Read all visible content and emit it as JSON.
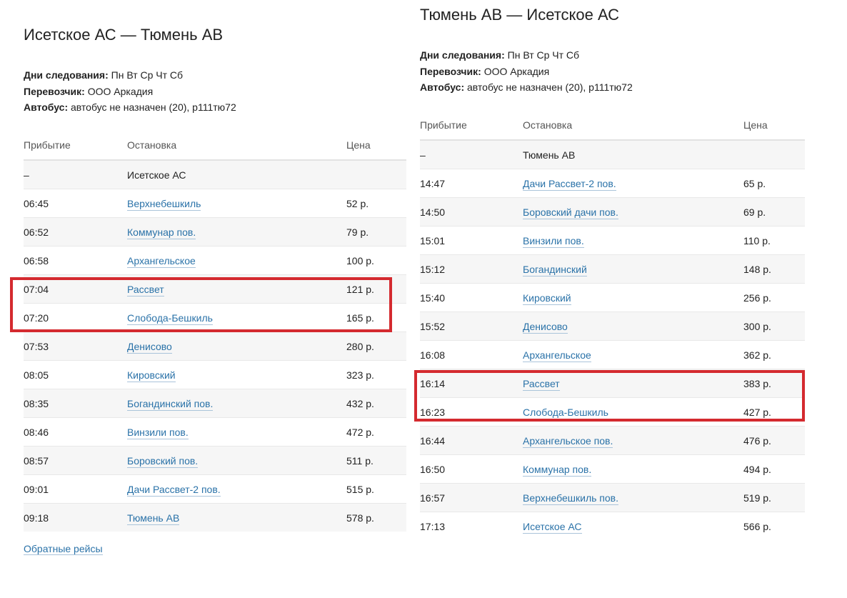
{
  "left": {
    "title": "Исетское АС — Тюмень АВ",
    "days_label": "Дни следования:",
    "days_value": "Пн Вт Ср Чт Сб",
    "carrier_label": "Перевозчик:",
    "carrier_value": "ООО Аркадия",
    "bus_label": "Автобус:",
    "bus_value": "автобус не назначен (20), р111тю72",
    "headers": {
      "arrival": "Прибытие",
      "stop": "Остановка",
      "price": "Цена"
    },
    "rows": [
      {
        "time": "–",
        "stop": "Исетское АС",
        "price": "",
        "link": false
      },
      {
        "time": "06:45",
        "stop": "Верхнебешкиль",
        "price": "52 р.",
        "link": true
      },
      {
        "time": "06:52",
        "stop": "Коммунар пов.",
        "price": "79 р.",
        "link": true
      },
      {
        "time": "06:58",
        "stop": "Архангельское",
        "price": "100 р.",
        "link": true
      },
      {
        "time": "07:04",
        "stop": "Рассвет",
        "price": "121 р.",
        "link": true
      },
      {
        "time": "07:20",
        "stop": "Слобода-Бешкиль",
        "price": "165 р.",
        "link": true
      },
      {
        "time": "07:53",
        "stop": "Денисово",
        "price": "280 р.",
        "link": true
      },
      {
        "time": "08:05",
        "stop": "Кировский",
        "price": "323 р.",
        "link": true
      },
      {
        "time": "08:35",
        "stop": "Богандинский пов.",
        "price": "432 р.",
        "link": true
      },
      {
        "time": "08:46",
        "stop": "Винзили пов.",
        "price": "472 р.",
        "link": true
      },
      {
        "time": "08:57",
        "stop": "Боровский пов.",
        "price": "511 р.",
        "link": true
      },
      {
        "time": "09:01",
        "stop": "Дачи Рассвет-2 пов.",
        "price": "515 р.",
        "link": true
      },
      {
        "time": "09:18",
        "stop": "Тюмень АВ",
        "price": "578 р.",
        "link": true
      }
    ],
    "back_link": "Обратные рейсы"
  },
  "right": {
    "title": "Тюмень АВ — Исетское АС",
    "days_label": "Дни следования:",
    "days_value": "Пн Вт Ср Чт Сб",
    "carrier_label": "Перевозчик:",
    "carrier_value": "ООО Аркадия",
    "bus_label": "Автобус:",
    "bus_value": "автобус не назначен (20), р111тю72",
    "headers": {
      "arrival": "Прибытие",
      "stop": "Остановка",
      "price": "Цена"
    },
    "rows": [
      {
        "time": "–",
        "stop": "Тюмень АВ",
        "price": "",
        "link": false
      },
      {
        "time": "14:47",
        "stop": "Дачи Рассвет-2 пов.",
        "price": "65 р.",
        "link": true
      },
      {
        "time": "14:50",
        "stop": "Боровский дачи пов.",
        "price": "69 р.",
        "link": true
      },
      {
        "time": "15:01",
        "stop": "Винзили пов.",
        "price": "110 р.",
        "link": true
      },
      {
        "time": "15:12",
        "stop": "Богандинский",
        "price": "148 р.",
        "link": true
      },
      {
        "time": "15:40",
        "stop": "Кировский",
        "price": "256 р.",
        "link": true
      },
      {
        "time": "15:52",
        "stop": "Денисово",
        "price": "300 р.",
        "link": true
      },
      {
        "time": "16:08",
        "stop": "Архангельское",
        "price": "362 р.",
        "link": true
      },
      {
        "time": "16:14",
        "stop": "Рассвет",
        "price": "383 р.",
        "link": true
      },
      {
        "time": "16:23",
        "stop": "Слобода-Бешкиль",
        "price": "427 р.",
        "link": true
      },
      {
        "time": "16:44",
        "stop": "Архангельское пов.",
        "price": "476 р.",
        "link": true
      },
      {
        "time": "16:50",
        "stop": "Коммунар пов.",
        "price": "494 р.",
        "link": true
      },
      {
        "time": "16:57",
        "stop": "Верхнебешкиль пов.",
        "price": "519 р.",
        "link": true
      },
      {
        "time": "17:13",
        "stop": "Исетское АС",
        "price": "566 р.",
        "link": true
      }
    ]
  },
  "colors": {
    "link": "#2a72a8",
    "highlight": "#d42a2f",
    "row_alt": "#f6f6f6"
  }
}
